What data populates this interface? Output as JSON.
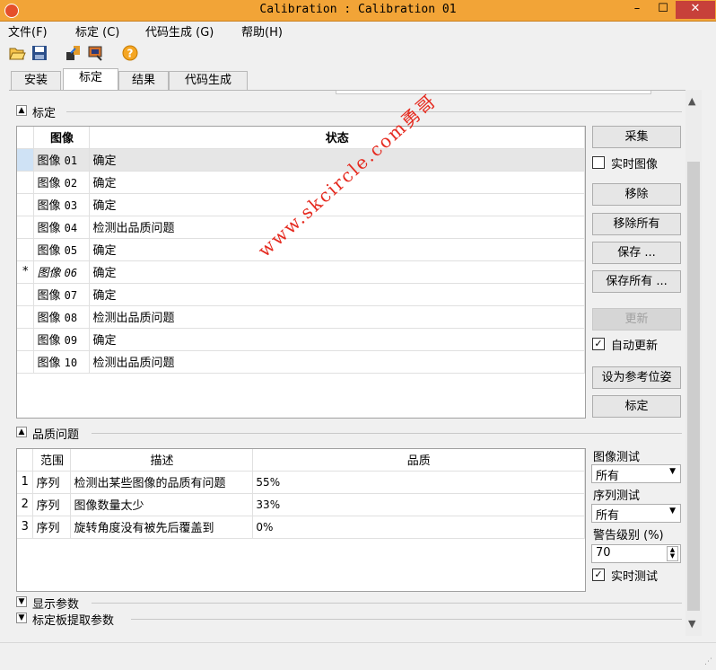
{
  "window": {
    "title": "Calibration : Calibration 01"
  },
  "menu": [
    "文件(F)",
    "标定 (C)",
    "代码生成 (G)",
    "帮助(H)"
  ],
  "toolbar": [
    "open-folder-icon",
    "save-icon",
    "import-icon",
    "export-image-icon",
    "help-icon"
  ],
  "tabs": [
    {
      "label": "安装"
    },
    {
      "label": "标定",
      "active": true
    },
    {
      "label": "结果"
    },
    {
      "label": "代码生成"
    }
  ],
  "calibration": {
    "section_label": "标定",
    "columns": [
      "图像",
      "状态"
    ],
    "rows": [
      {
        "marker": "",
        "name": "图像",
        "num": "01",
        "status": "确定",
        "selected": true
      },
      {
        "marker": "",
        "name": "图像",
        "num": "02",
        "status": "确定"
      },
      {
        "marker": "",
        "name": "图像",
        "num": "03",
        "status": "确定"
      },
      {
        "marker": "",
        "name": "图像",
        "num": "04",
        "status": "检测出品质问题"
      },
      {
        "marker": "",
        "name": "图像",
        "num": "05",
        "status": "确定"
      },
      {
        "marker": "*",
        "name": "图像",
        "num": "06",
        "status": "确定",
        "italic": true
      },
      {
        "marker": "",
        "name": "图像",
        "num": "07",
        "status": "确定"
      },
      {
        "marker": "",
        "name": "图像",
        "num": "08",
        "status": "检测出品质问题"
      },
      {
        "marker": "",
        "name": "图像",
        "num": "09",
        "status": "确定"
      },
      {
        "marker": "",
        "name": "图像",
        "num": "10",
        "status": "检测出品质问题"
      }
    ],
    "buttons": {
      "acquire": "采集",
      "live_image": "实时图像",
      "remove": "移除",
      "remove_all": "移除所有",
      "save": "保存 ...",
      "save_all": "保存所有 ...",
      "update": "更新",
      "auto_update": "自动更新",
      "set_reference_pose": "设为参考位姿",
      "calibrate": "标定"
    },
    "live_image_checked": false,
    "auto_update_checked": true
  },
  "quality": {
    "section_label": "品质问题",
    "columns": [
      "范围",
      "描述",
      "品质"
    ],
    "rows": [
      {
        "idx": "1",
        "scope": "序列",
        "desc": "检测出某些图像的品质有问题",
        "quality": "55%"
      },
      {
        "idx": "2",
        "scope": "序列",
        "desc": "图像数量太少",
        "quality": "33%"
      },
      {
        "idx": "3",
        "scope": "序列",
        "desc": "旋转角度没有被先后覆盖到",
        "quality": "0%"
      }
    ],
    "image_test_label": "图像测试",
    "image_test_value": "所有",
    "sequence_test_label": "序列测试",
    "sequence_test_value": "所有",
    "warning_level_label": "警告级别 (%)",
    "warning_level_value": "70",
    "live_test_label": "实时测试",
    "live_test_checked": true
  },
  "collapsed_sections": [
    "显示参数",
    "标定板提取参数"
  ],
  "watermark": "www.skcircle.com勇哥"
}
